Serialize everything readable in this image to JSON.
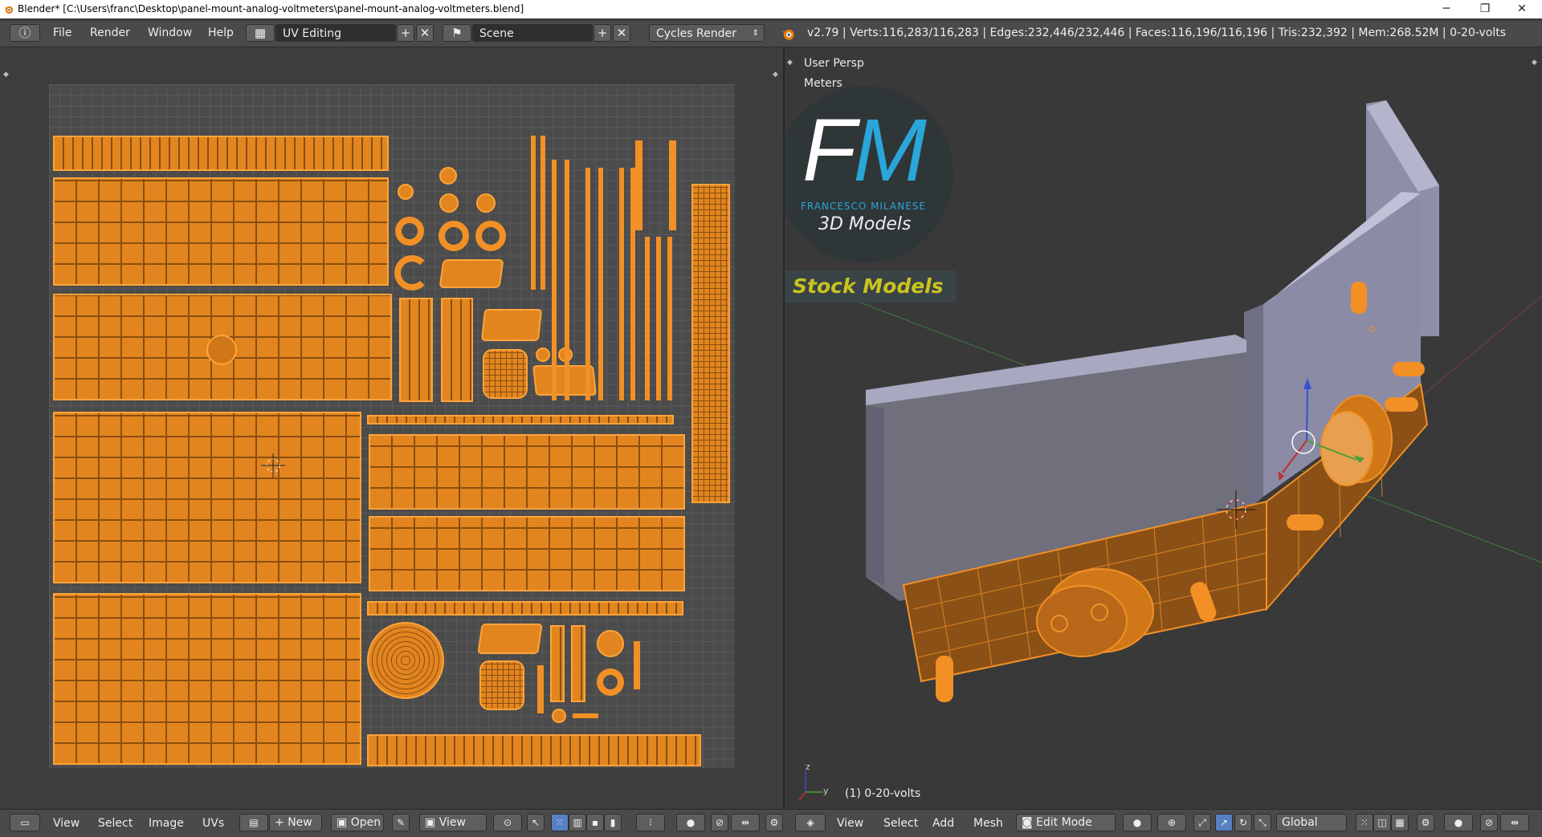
{
  "window": {
    "title": "Blender* [C:\\Users\\franc\\Desktop\\panel-mount-analog-voltmeters\\panel-mount-analog-voltmeters.blend]",
    "controls": {
      "minimize": "─",
      "maximize": "❐",
      "close": "✕"
    }
  },
  "topbar": {
    "menus": [
      "File",
      "Render",
      "Window",
      "Help"
    ],
    "screen_layout": "UV Editing",
    "scene": "Scene",
    "render_engine": "Cycles Render",
    "stats": "v2.79 | Verts:116,283/116,283 | Edges:232,446/232,446 | Faces:116,196/116,196 | Tris:232,392 | Mem:268.52M | 0-20-volts"
  },
  "viewport": {
    "view_name": "User Persp",
    "units": "Meters",
    "object_label": "(1) 0-20-volts",
    "logo": {
      "initials": "FM",
      "name": "FRANCESCO MILANESE",
      "tagline": "3D Models",
      "banner": "Stock Models"
    }
  },
  "uv_editor_header": {
    "menus": [
      "View",
      "Select",
      "Image",
      "UVs"
    ],
    "new_label": "New",
    "open_label": "Open",
    "view_label": "View"
  },
  "view3d_header": {
    "menus": [
      "View",
      "Select",
      "Add",
      "Mesh"
    ],
    "mode": "Edit Mode",
    "orientation": "Global"
  },
  "colors": {
    "accent": "#f29026",
    "selected_button": "#5680c2",
    "logo_blue": "#2aa6d9",
    "banner_yellow": "#c8c41e"
  }
}
